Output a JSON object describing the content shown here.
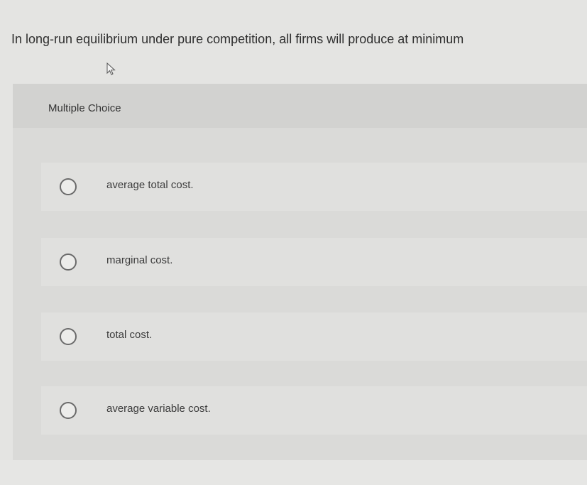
{
  "question": {
    "text": "In long-run equilibrium under pure competition, all firms will produce at minimum"
  },
  "question_type": {
    "label": "Multiple Choice"
  },
  "options": [
    {
      "label": "average total cost."
    },
    {
      "label": "marginal cost."
    },
    {
      "label": "total cost."
    },
    {
      "label": "average variable cost."
    }
  ],
  "icons": {
    "cursor": "mouse-pointer-icon",
    "radio": "radio-button-icon"
  },
  "colors": {
    "background": "#e4e4e2",
    "panel": "#dadad8",
    "header": "#d2d2d0",
    "option_row": "#e0e0de",
    "text": "#3a3a3a"
  }
}
